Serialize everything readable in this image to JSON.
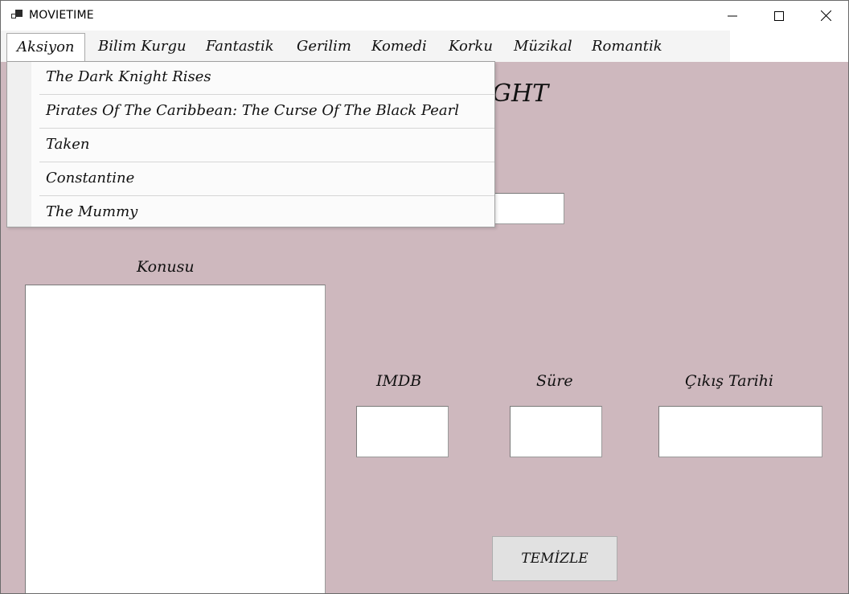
{
  "window": {
    "title": "MOVIETIME"
  },
  "menu": {
    "items": [
      "Aksiyon",
      "Bilim Kurgu",
      "Fantastik",
      "Gerilim",
      "Komedi",
      "Korku",
      "Müzikal",
      "Romantik"
    ],
    "active_index": 0
  },
  "dropdown": {
    "items": [
      "The Dark Knight Rises",
      "Pirates Of The Caribbean: The Curse Of The Black Pearl",
      "Taken",
      "Constantine",
      "The Mummy"
    ]
  },
  "main": {
    "movie_title_fragment": "GHT",
    "konusu_label": "Konusu",
    "imdb_label": "IMDB",
    "sure_label": "Süre",
    "cikis_label": "Çıkış Tarihi",
    "clear_button": "TEMİZLE"
  },
  "colors": {
    "content_bg": "#ceb8be",
    "menubar_bg": "#f4f4f4"
  }
}
